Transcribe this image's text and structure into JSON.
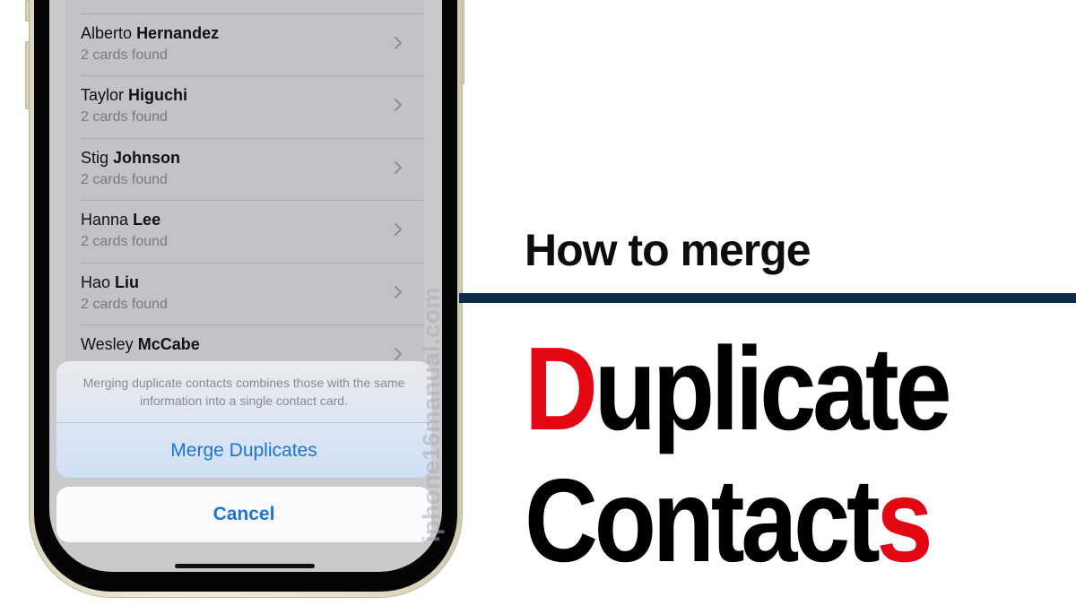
{
  "phone": {
    "contacts": [
      {
        "first": "Alberto",
        "last": "Hernandez",
        "detail": "2 cards found"
      },
      {
        "first": "Taylor",
        "last": "Higuchi",
        "detail": "2 cards found"
      },
      {
        "first": "Stig",
        "last": "Johnson",
        "detail": "2 cards found"
      },
      {
        "first": "Hanna",
        "last": "Lee",
        "detail": "2 cards found"
      },
      {
        "first": "Hao",
        "last": "Liu",
        "detail": "2 cards found"
      },
      {
        "first": "Wesley",
        "last": "McCabe",
        "detail": ""
      }
    ],
    "action_sheet": {
      "message": "Merging duplicate contacts combines those with the same information into a single contact card.",
      "merge_label": "Merge Duplicates",
      "cancel_label": "Cancel"
    },
    "watermark": "iphone16manual.com",
    "icons": {
      "row_chevron": "chevron-right-icon"
    }
  },
  "headline": {
    "subtitle": "How to merge",
    "line1_accent": "D",
    "line1_rest": "uplicate",
    "line2_rest": "Contact",
    "line2_accent": "s"
  },
  "colors": {
    "accent_red": "#e30613",
    "rule_navy": "#0f2a4a",
    "ios_blue": "#1c74d6"
  }
}
